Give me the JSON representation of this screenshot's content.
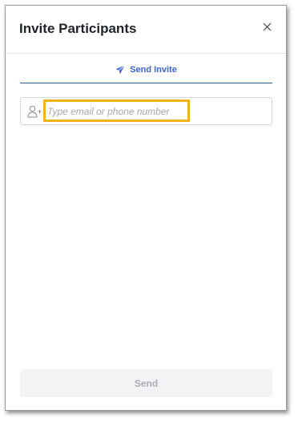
{
  "dialog": {
    "title": "Invite Participants",
    "close_icon": "close-icon"
  },
  "tab": {
    "icon": "paper-plane-icon",
    "label": "Send Invite"
  },
  "invite_input": {
    "icon": "user-add-icon",
    "placeholder": "Type email or phone number",
    "value": ""
  },
  "footer": {
    "send_label": "Send",
    "send_enabled": false
  },
  "colors": {
    "accent": "#3d62d8",
    "tab_underline": "#2c5d8a",
    "highlight": "#f2b21c",
    "disabled_button_bg": "#f2f3f5",
    "disabled_button_text": "#a9adb3"
  }
}
